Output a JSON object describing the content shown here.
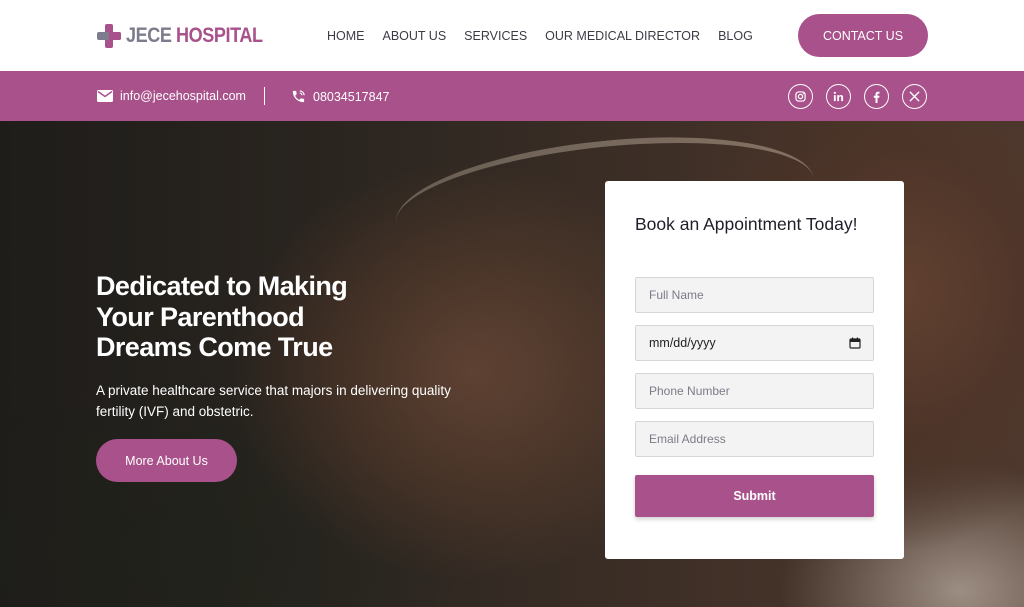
{
  "logo": {
    "part1": "JECE",
    "part2": "HOSPITAL"
  },
  "nav": [
    {
      "label": "HOME"
    },
    {
      "label": "ABOUT US"
    },
    {
      "label": "SERVICES"
    },
    {
      "label": "OUR MEDICAL DIRECTOR"
    },
    {
      "label": "BLOG"
    }
  ],
  "header": {
    "contact_label": "CONTACT US"
  },
  "topbar": {
    "email": "info@jecehospital.com",
    "phone": "08034517847",
    "socials": [
      "instagram-icon",
      "linkedin-icon",
      "facebook-icon",
      "x-icon"
    ]
  },
  "hero": {
    "title": "Dedicated to Making Your Parenthood Dreams Come True",
    "text": "A private healthcare service that majors in delivering quality fertility (IVF) and obstetric.",
    "button_label": "More About Us"
  },
  "appointment": {
    "title": "Book an Appointment Today!",
    "fields": {
      "full_name_placeholder": "Full Name",
      "date_value": "mm/dd/yyyy",
      "phone_placeholder": "Phone Number",
      "email_placeholder": "Email Address"
    },
    "submit_label": "Submit"
  },
  "colors": {
    "brand": "#a8518a",
    "logo_gray": "#7c7c8c"
  }
}
